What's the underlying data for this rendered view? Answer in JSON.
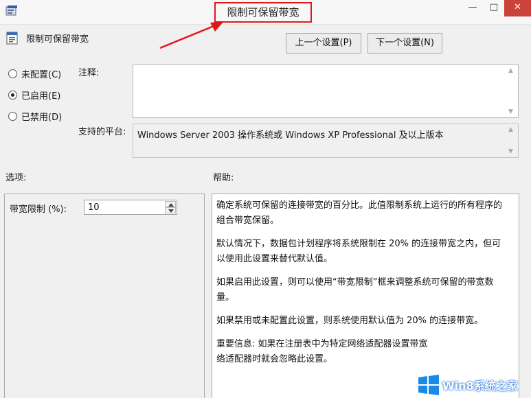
{
  "window": {
    "title": "限制可保留带宽",
    "minimize": "—",
    "maximize": "□",
    "close": "✕",
    "icon": "policy-editor-icon",
    "accent_color": "#e0181c"
  },
  "policy": {
    "name": "限制可保留带宽",
    "prev_button": "上一个设置(P)",
    "next_button": "下一个设置(N)"
  },
  "state": {
    "not_configured": "未配置(C)",
    "enabled": "已启用(E)",
    "disabled": "已禁用(D)",
    "selected": "enabled"
  },
  "comment": {
    "label": "注释:",
    "value": ""
  },
  "platform": {
    "label": "支持的平台:",
    "value": "Windows Server 2003 操作系统或 Windows XP Professional 及以上版本"
  },
  "options": {
    "label": "选项:",
    "bandwidth_label": "带宽限制 (%):",
    "bandwidth_value": "10"
  },
  "help": {
    "label": "帮助:",
    "paragraphs": [
      "确定系统可保留的连接带宽的百分比。此值限制系统上运行的所有程序的组合带宽保留。",
      "默认情况下，数据包计划程序将系统限制在 20% 的连接带宽之内，但可以使用此设置来替代默认值。",
      "如果启用此设置，则可以使用“带宽限制”框来调整系统可保留的带宽数量。",
      "如果禁用或未配置此设置，则系统使用默认值为 20% 的连接带宽。",
      "重要信息: 如果在注册表中为特定网络适配器设置带宽",
      "络适配器时就会忽略此设置。"
    ]
  },
  "watermark": {
    "text": "Win8系统之家",
    "logo": "windows-logo-icon"
  }
}
